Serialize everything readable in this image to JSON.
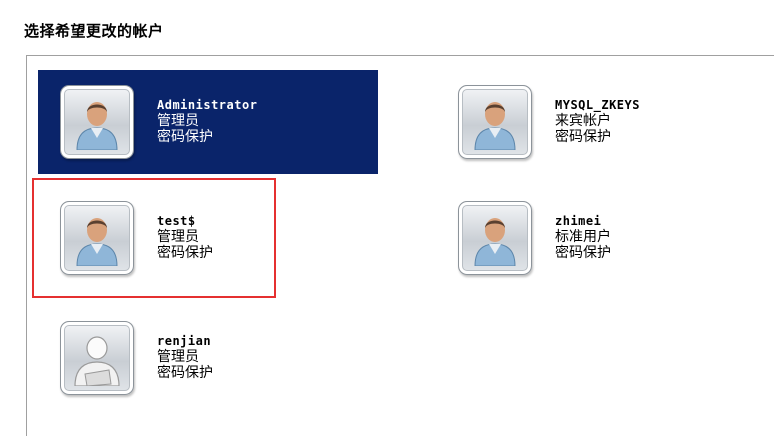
{
  "heading": "选择希望更改的帐户",
  "accounts": [
    {
      "username": "Administrator",
      "type": "管理员",
      "status": "密码保护",
      "icon": "user-avatar-icon",
      "selected": true
    },
    {
      "username": "MYSQL_ZKEYS",
      "type": "来宾帐户",
      "status": "密码保护",
      "icon": "user-avatar-icon",
      "selected": false
    },
    {
      "username": "test$",
      "type": "管理员",
      "status": "密码保护",
      "icon": "user-avatar-icon",
      "selected": false,
      "highlighted": true
    },
    {
      "username": "zhimei",
      "type": "标准用户",
      "status": "密码保护",
      "icon": "user-avatar-icon",
      "selected": false
    },
    {
      "username": "renjian",
      "type": "管理员",
      "status": "密码保护",
      "icon": "guest-avatar-icon",
      "selected": false
    }
  ],
  "colors": {
    "selection": "#0a246a",
    "highlight_border": "#e53030"
  }
}
